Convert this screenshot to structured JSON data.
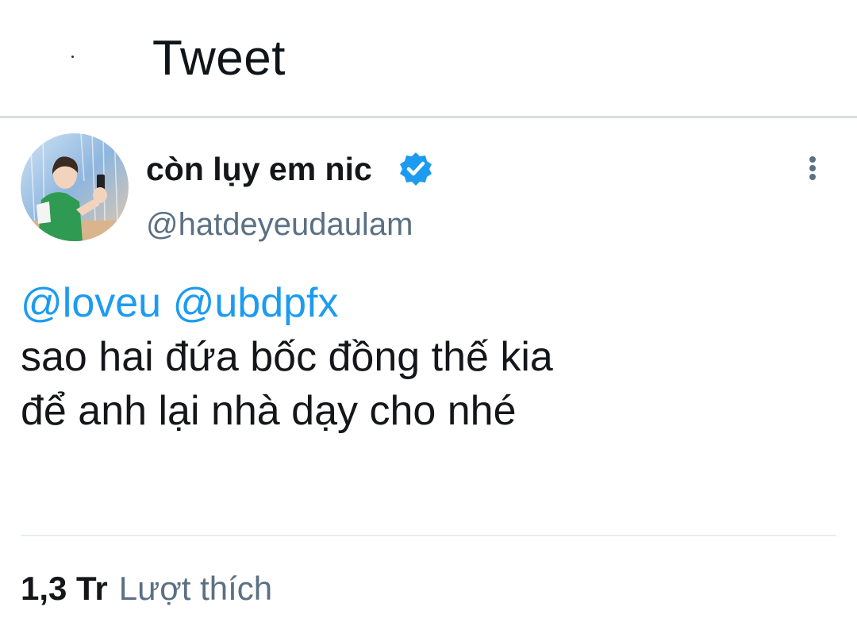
{
  "header": {
    "title": "Tweet"
  },
  "tweet": {
    "display_name": "còn lụy em nic",
    "handle": "@hatdeyeudaulam",
    "mentions": [
      "@loveu",
      "@ubdpfx"
    ],
    "text_lines": [
      "sao hai đứa bốc đồng thế kia",
      "để anh lại nhà dạy cho nhé"
    ]
  },
  "stats": {
    "likes_count": "1,3 Tr",
    "likes_label": "Lượt thích"
  },
  "icons": {
    "verified": "verified-badge-icon",
    "more": "more-vertical-icon"
  },
  "colors": {
    "accent": "#1d9bf0",
    "secondary_text": "#5b7083",
    "divider": "#d9dde1"
  }
}
